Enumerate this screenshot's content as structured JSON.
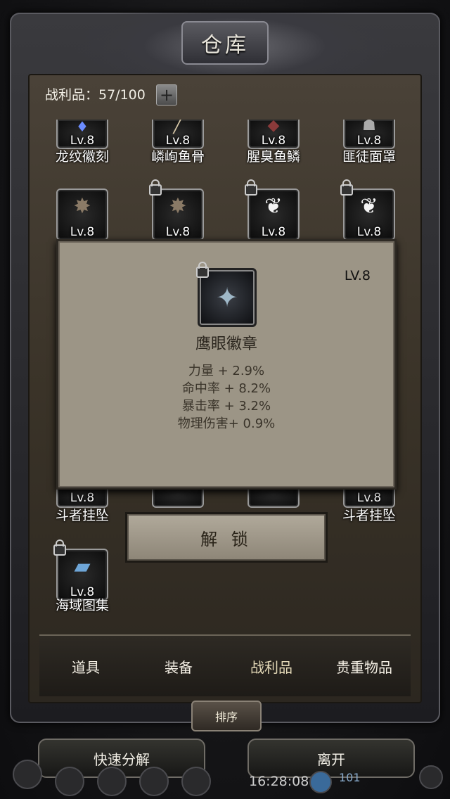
{
  "window": {
    "title": "仓库"
  },
  "capacity": {
    "label": "战利品：57/100",
    "add": "+"
  },
  "items": [
    {
      "name": "龙纹徽刻",
      "level": "Lv.8",
      "icon": "amulet-icon",
      "locked": false
    },
    {
      "name": "嶙峋鱼骨",
      "level": "Lv.8",
      "icon": "fishbone-icon",
      "locked": false
    },
    {
      "name": "腥臭鱼鳞",
      "level": "Lv.8",
      "icon": "scale-icon",
      "locked": false
    },
    {
      "name": "匪徒面罩",
      "level": "Lv.8",
      "icon": "mask-icon",
      "locked": false
    },
    {
      "name": "",
      "level": "Lv.8",
      "icon": "claw-icon",
      "locked": false
    },
    {
      "name": "",
      "level": "Lv.8",
      "icon": "claw-icon",
      "locked": true
    },
    {
      "name": "",
      "level": "Lv.8",
      "icon": "wing-icon",
      "locked": true
    },
    {
      "name": "",
      "level": "Lv.8",
      "icon": "wing-icon",
      "locked": true
    },
    {
      "name": "斗者挂坠",
      "level": "Lv.8",
      "icon": "pendant-icon",
      "locked": false
    },
    {
      "name": "斗者挂坠",
      "level": "Lv.8",
      "icon": "pendant-icon",
      "locked": false
    },
    {
      "name": "海域图集",
      "level": "Lv.8",
      "icon": "book-icon",
      "locked": true
    }
  ],
  "tooltip": {
    "level": "LV.8",
    "name": "鹰眼徽章",
    "icon": "eagle-badge-icon",
    "stats": [
      "力量 + 2.9%",
      "命中率 + 8.2%",
      "暴击率 + 3.2%",
      "物理伤害+ 0.9%"
    ]
  },
  "unlock_button": "解 锁",
  "tabs": [
    {
      "label": "道具",
      "active": false
    },
    {
      "label": "装备",
      "active": false
    },
    {
      "label": "战利品",
      "active": true
    },
    {
      "label": "贵重物品",
      "active": false
    }
  ],
  "sort_button": "排序",
  "bottom": {
    "salvage_button": "快速分解",
    "leave_button": "离开"
  },
  "status": {
    "clock": "16:28:08",
    "count": "101"
  }
}
